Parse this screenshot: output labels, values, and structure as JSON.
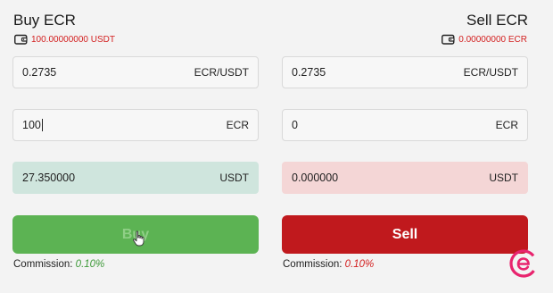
{
  "buy": {
    "title": "Buy ECR",
    "balance": "100.00000000 USDT",
    "price": {
      "value": "0.2735",
      "unit": "ECR/USDT"
    },
    "amount": {
      "value": "100",
      "unit": "ECR"
    },
    "total": {
      "value": "27.350000",
      "unit": "USDT"
    },
    "button": "Buy",
    "commission_label": "Commission:",
    "commission_rate": "0.10%"
  },
  "sell": {
    "title": "Sell ECR",
    "balance": "0.00000000 ECR",
    "price": {
      "value": "0.2735",
      "unit": "ECR/USDT"
    },
    "amount": {
      "value": "0",
      "unit": "ECR"
    },
    "total": {
      "value": "0.000000",
      "unit": "USDT"
    },
    "button": "Sell",
    "commission_label": "Commission:",
    "commission_rate": "0.10%"
  },
  "colors": {
    "buy_button": "#5cb353",
    "sell_button": "#c0191d",
    "balance_text": "#d32020",
    "buy_total_bg": "#cfe5dd",
    "sell_total_bg": "#f4d6d6"
  },
  "icons": [
    "wallet-icon",
    "hand-cursor-icon",
    "brand-logo-icon"
  ]
}
